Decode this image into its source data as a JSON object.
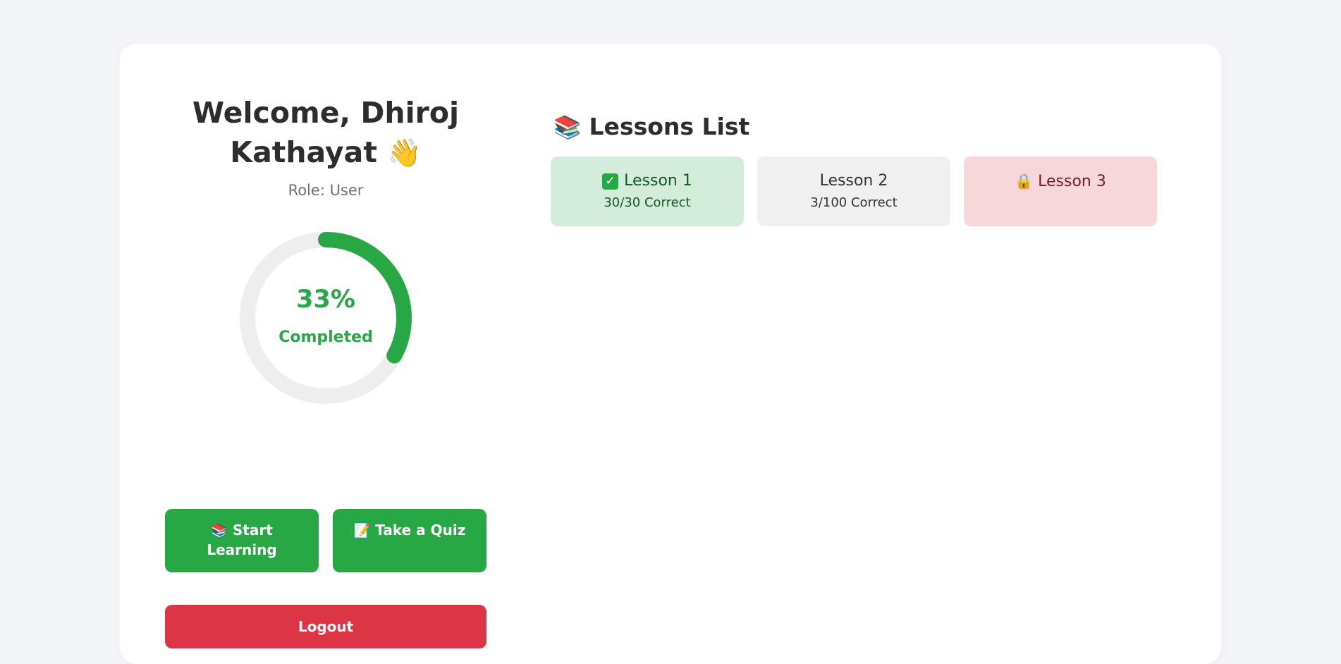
{
  "welcome": {
    "line1": "Welcome, Dhiroj",
    "line2": "Kathayat",
    "wave_emoji": "👋",
    "role": "Role: User"
  },
  "progress": {
    "percent": 33,
    "percent_text": "33%",
    "label": "Completed",
    "color": "#28a745",
    "track_color": "#eeeeee"
  },
  "actions": {
    "start_emoji": "📚",
    "start_line1": "Start",
    "start_line2": "Learning",
    "quiz_emoji": "📝",
    "quiz_label": "Take a Quiz",
    "logout_label": "Logout"
  },
  "lessons": {
    "title_emoji": "📚",
    "title": "Lessons List",
    "items": [
      {
        "status": "completed",
        "status_icon": "check-icon",
        "name": "Lesson 1",
        "score": "30/30 Correct"
      },
      {
        "status": "in-progress",
        "name": "Lesson 2",
        "score": "3/100 Correct"
      },
      {
        "status": "locked",
        "status_icon": "lock-icon",
        "status_emoji": "🔒",
        "name": "Lesson 3"
      }
    ]
  },
  "colors": {
    "success": "#28a745",
    "danger": "#dc3545",
    "completed_bg": "#d4edda",
    "locked_bg": "#f8d7da",
    "neutral_bg": "#f0f0f0"
  }
}
